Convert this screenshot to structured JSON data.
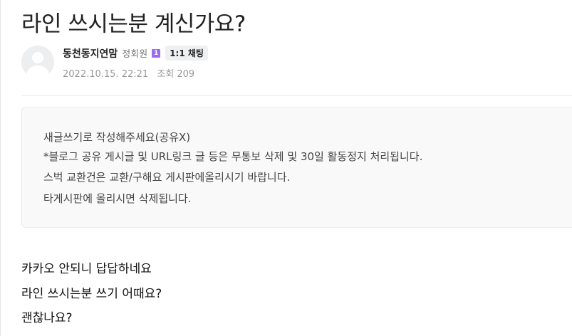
{
  "post": {
    "title": "라인 쓰시는분 계신가요?",
    "author": "동천동지연맘",
    "grade": "정회원",
    "grade_icon_text": "1",
    "chat_label": "1:1 채팅",
    "date": "2022.10.15. 22:21",
    "views": "조회 209"
  },
  "notice": {
    "lines": [
      "새글쓰기로 작성해주세요(공유X)",
      "*블로그 공유 게시글 및 URL링크 글 등은 무통보 삭제 및 30일 활동정지 처리됩니다.",
      "스벅 교환건은 교환/구해요 게시판에올리시기 바랍니다.",
      "타게시판에 올리시면 삭제됩니다."
    ]
  },
  "content": {
    "lines": [
      "카카오 안되니 답답하네요",
      "라인 쓰시는분 쓰기 어때요?",
      "괜찮나요?"
    ]
  },
  "colors": {
    "grade_icon": "#9b6cf0",
    "notice_bg": "#f9f9fa",
    "chat_bg": "#eff0f2"
  }
}
